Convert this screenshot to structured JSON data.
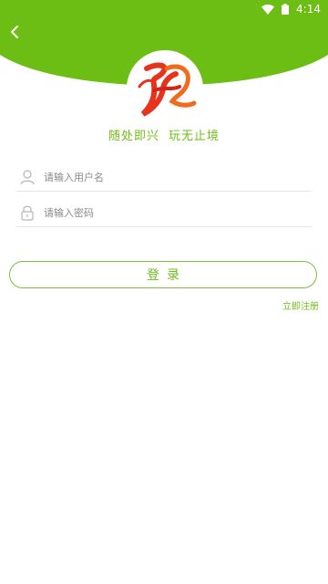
{
  "status_bar": {
    "time": "4:14"
  },
  "header": {
    "back_icon": "chevron-left-icon",
    "color": "#6dbe14"
  },
  "logo": {
    "brand_colors": [
      "#e8331c",
      "#f26a1b"
    ]
  },
  "slogan": {
    "part1": "随处即兴",
    "part2": "玩无止境"
  },
  "form": {
    "username": {
      "placeholder": "请输入用户名",
      "value": "",
      "icon": "user-icon"
    },
    "password": {
      "placeholder": "请输入密码",
      "value": "",
      "icon": "lock-icon"
    }
  },
  "login_button": {
    "label": "登录"
  },
  "register_link": {
    "label": "立即注册"
  },
  "colors": {
    "accent": "#6fbe16"
  }
}
